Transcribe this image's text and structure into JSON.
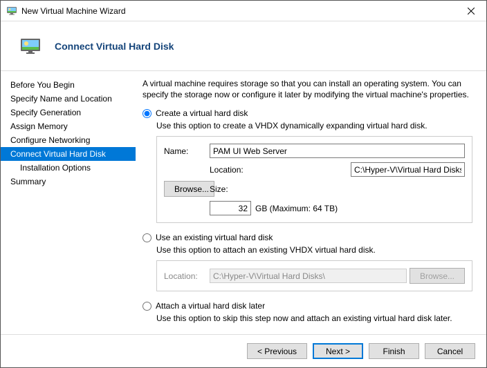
{
  "window": {
    "title": "New Virtual Machine Wizard"
  },
  "page": {
    "heading": "Connect Virtual Hard Disk"
  },
  "sidebar": {
    "items": [
      {
        "label": "Before You Begin"
      },
      {
        "label": "Specify Name and Location"
      },
      {
        "label": "Specify Generation"
      },
      {
        "label": "Assign Memory"
      },
      {
        "label": "Configure Networking"
      },
      {
        "label": "Connect Virtual Hard Disk"
      },
      {
        "label": "Installation Options"
      },
      {
        "label": "Summary"
      }
    ],
    "selected_index": 5
  },
  "intro": "A virtual machine requires storage so that you can install an operating system. You can specify the storage now or configure it later by modifying the virtual machine's properties.",
  "options": {
    "selected": "create",
    "create": {
      "label": "Create a virtual hard disk",
      "desc": "Use this option to create a VHDX dynamically expanding virtual hard disk.",
      "name_label": "Name:",
      "name_value": "PAM UI Web Server",
      "location_label": "Location:",
      "location_value": "C:\\Hyper-V\\Virtual Hard Disks\\",
      "browse_label": "Browse...",
      "size_label": "Size:",
      "size_value": "32",
      "size_units": "GB (Maximum: 64 TB)"
    },
    "existing": {
      "label": "Use an existing virtual hard disk",
      "desc": "Use this option to attach an existing VHDX virtual hard disk.",
      "location_label": "Location:",
      "location_value": "C:\\Hyper-V\\Virtual Hard Disks\\",
      "browse_label": "Browse..."
    },
    "later": {
      "label": "Attach a virtual hard disk later",
      "desc": "Use this option to skip this step now and attach an existing virtual hard disk later."
    }
  },
  "buttons": {
    "previous": "< Previous",
    "next": "Next >",
    "finish": "Finish",
    "cancel": "Cancel"
  }
}
